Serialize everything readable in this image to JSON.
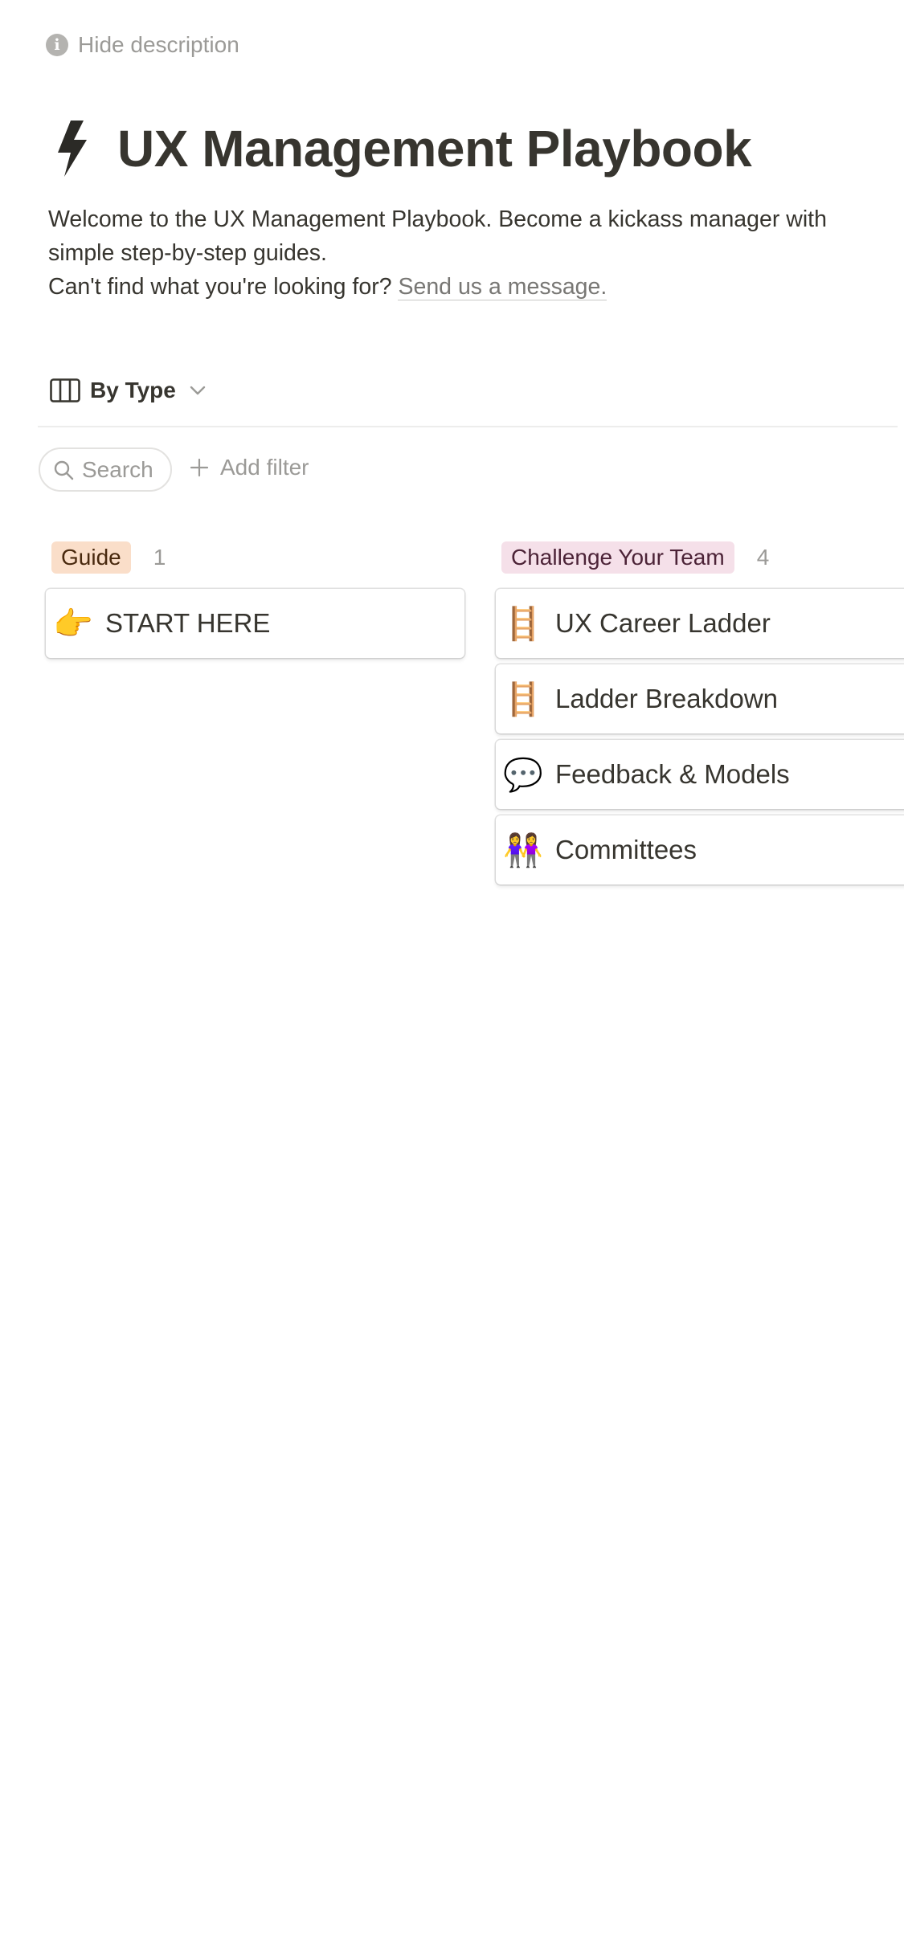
{
  "header": {
    "hide_description": "Hide description",
    "title": "UX Management Playbook",
    "description_line1": "Welcome to the UX Management Playbook. Become a kickass manager with simple step-by-step guides.",
    "description_line2_prefix": "Can't find what you're looking for?",
    "description_link": "Send us a message."
  },
  "view": {
    "label": "By Type"
  },
  "toolbar": {
    "search_label": "Search",
    "add_filter_label": "Add filter"
  },
  "groups": [
    {
      "tag": "Guide",
      "count": "1",
      "color": "#fadec9",
      "cards": [
        {
          "icon": "backhand-pointing-right-icon",
          "emoji": "👉",
          "title": "START HERE"
        }
      ]
    },
    {
      "tag": "Challenge Your Team",
      "count": "4",
      "color": "#f5e0e9",
      "cards": [
        {
          "icon": "ladder-icon",
          "emoji": "🪜",
          "title": "UX Career Ladder"
        },
        {
          "icon": "ladder-icon",
          "emoji": "🪜",
          "title": "Ladder Breakdown"
        },
        {
          "icon": "speech-balloon-icon",
          "emoji": "💬",
          "title": "Feedback & Models"
        },
        {
          "icon": "people-holding-hands-icon",
          "emoji": "👭",
          "title": "Committees"
        }
      ]
    }
  ]
}
